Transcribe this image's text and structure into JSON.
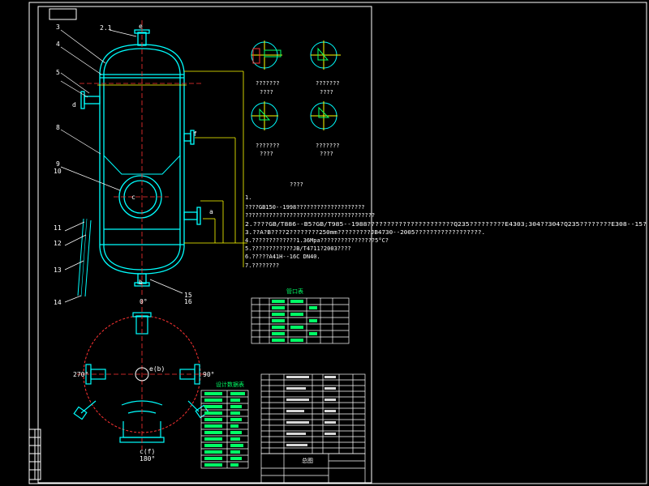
{
  "part_labels": {
    "p3": "3",
    "p21": "2.1",
    "p4": "4",
    "p5": "5",
    "p8": "8",
    "p9": "9",
    "p10": "10",
    "p11": "11",
    "p12": "12",
    "p13": "13",
    "p14": "14",
    "p15": "15",
    "p16": "16"
  },
  "nozzle_letters": {
    "e": "e",
    "d": "d",
    "f": "f",
    "c": "c",
    "a": "a",
    "b": "b"
  },
  "details": [
    {
      "caption": "???????",
      "sub": "????"
    },
    {
      "caption": "???????",
      "sub": "????"
    },
    {
      "caption": "???????",
      "sub": "????"
    },
    {
      "caption": "???????",
      "sub": "????"
    }
  ],
  "notes": {
    "heading": "????",
    "lines": [
      "1.",
      "????GB150--1998????????????????????",
      "??????????????????????????????????????",
      "2.????GB/T886--B5?GB/T985--1988??????????????????????Q235?????????E4303;304??304?Q235????????E308--15?",
      "3.??A?B????2????????250mm?????????JB4730--2005??????????????????.",
      "4.?????????????1.36Mpa????????????????5°C?",
      "5.????????????JB/T4711?2003????",
      "6.?????A41H--16C   DN40.",
      "7.????????"
    ]
  },
  "nozzle_table": {
    "title": "管口表"
  },
  "design_table": {
    "title": "设计数据表"
  },
  "title_block": {
    "name": "总图"
  },
  "plan_view": {
    "top": "0°",
    "left": "270°",
    "right": "90°",
    "bottom": "180°",
    "center": "e(b)",
    "bottom_nozzle": "c(f)"
  },
  "colors": {
    "vessel": "#00ffff",
    "centerline": "#ff3333",
    "dimension": "#ffff00",
    "table": "#00ff66",
    "frame": "#ffffff"
  }
}
